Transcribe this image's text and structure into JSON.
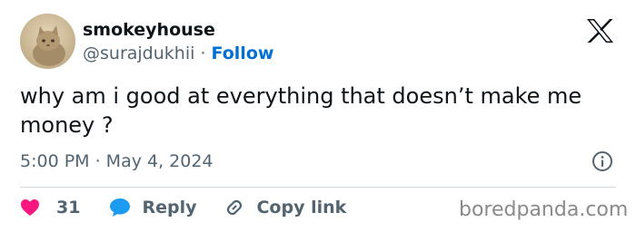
{
  "user": {
    "display_name": "smokeyhouse",
    "handle": "@surajdukhii",
    "separator": "·",
    "follow_label": "Follow"
  },
  "tweet": {
    "text": "why am i good at everything that doesn’t make me money ?",
    "timestamp": "5:00 PM · May 4, 2024"
  },
  "actions": {
    "likes_count": "31",
    "reply_label": "Reply",
    "copy_link_label": "Copy link"
  },
  "icons": {
    "brand": "x-logo-icon",
    "info": "info-icon",
    "like": "heart-icon",
    "reply": "speech-bubble-icon",
    "copy_link": "link-icon"
  },
  "colors": {
    "text_primary": "#0f1419",
    "text_secondary": "#536471",
    "follow_blue": "#006fd6",
    "like_pink": "#f91880",
    "reply_blue": "#1d9bf0",
    "divider": "#cfd9de"
  },
  "watermark": "boredpanda.com"
}
